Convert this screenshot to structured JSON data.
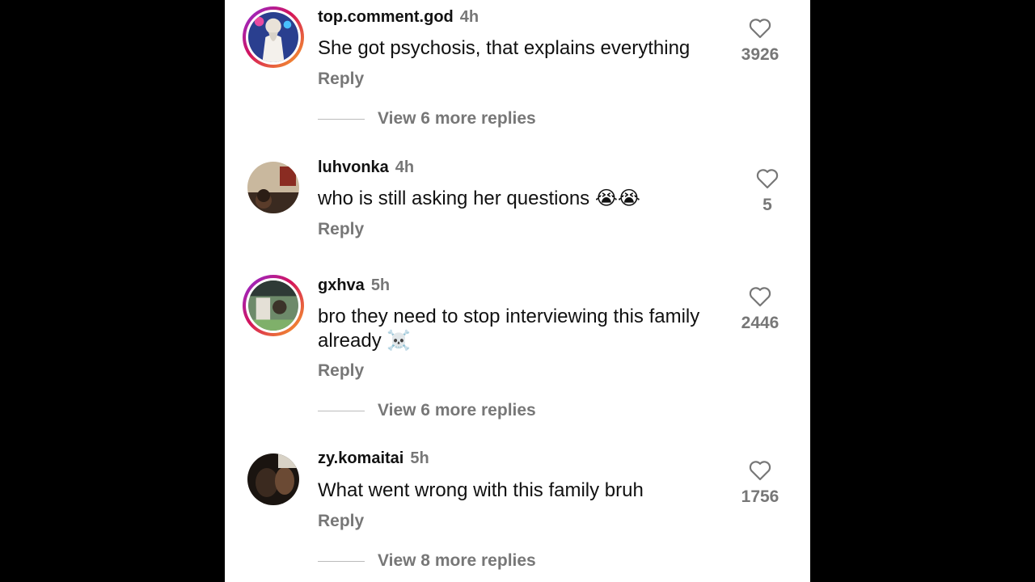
{
  "comments": [
    {
      "username": "top.comment.god",
      "time": "4h",
      "text": "She got psychosis, that explains everything",
      "reply_label": "Reply",
      "likes": "3926",
      "view_more": "View 6 more replies",
      "story_ring": true
    },
    {
      "username": "luhvonka",
      "time": "4h",
      "text": "who is still asking her questions 😭😭",
      "reply_label": "Reply",
      "likes": "5",
      "story_ring": false
    },
    {
      "username": "gxhva",
      "time": "5h",
      "text": "bro they need to stop interviewing this family already ☠️",
      "reply_label": "Reply",
      "likes": "2446",
      "view_more": "View 6 more replies",
      "story_ring": true
    },
    {
      "username": "zy.komaitai",
      "time": "5h",
      "text": "What went wrong with this family bruh",
      "reply_label": "Reply",
      "likes": "1756",
      "view_more": "View 8 more replies",
      "story_ring": false
    }
  ],
  "icons": {
    "like": "heart-outline-icon"
  },
  "colors": {
    "ring_start": "#8a2be2",
    "ring_mid": "#d4145a",
    "ring_end": "#f9a825",
    "muted": "#777777"
  }
}
